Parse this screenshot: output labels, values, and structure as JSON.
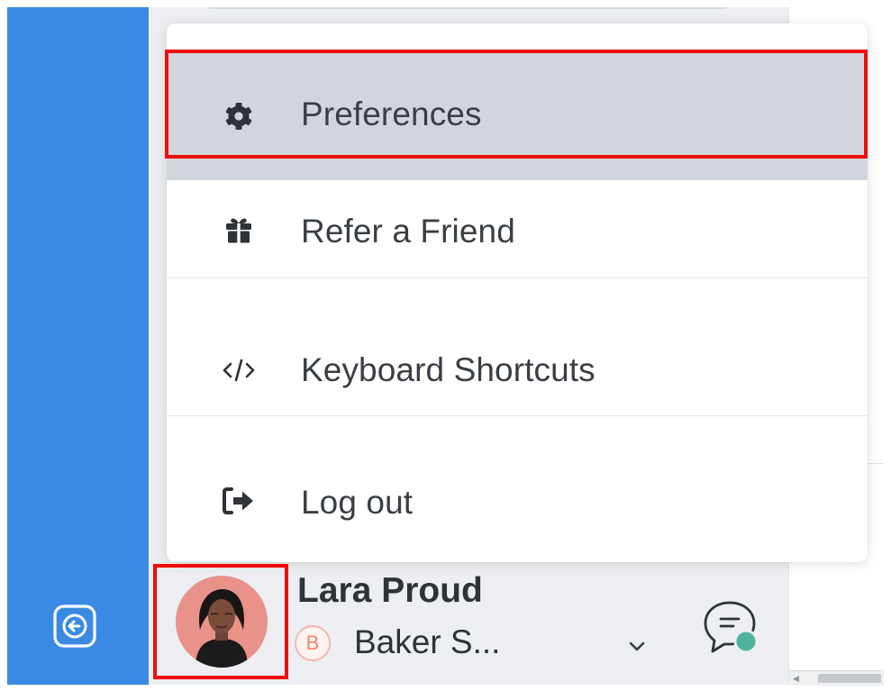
{
  "menu": {
    "items": [
      {
        "label": "Preferences",
        "icon": "gear-icon"
      },
      {
        "label": "Refer a Friend",
        "icon": "gift-icon"
      },
      {
        "label": "Keyboard Shortcuts",
        "icon": "code-icon"
      },
      {
        "label": "Log out",
        "icon": "logout-icon"
      }
    ]
  },
  "account": {
    "user_name": "Lara Proud",
    "org_initial": "B",
    "org_name": "Baker S..."
  },
  "colors": {
    "rail": "#3a8ae3",
    "sidebar": "#eceef1",
    "menu_hover": "#d1d6dd",
    "highlight": "#f10b0b",
    "org_badge": "#ee8674",
    "status_dot": "#4fb39a"
  },
  "icons": {
    "rail_collapse": "collapse-left-icon",
    "org_dropdown": "chevron-down-icon",
    "chat": "chat-bubble-icon"
  }
}
